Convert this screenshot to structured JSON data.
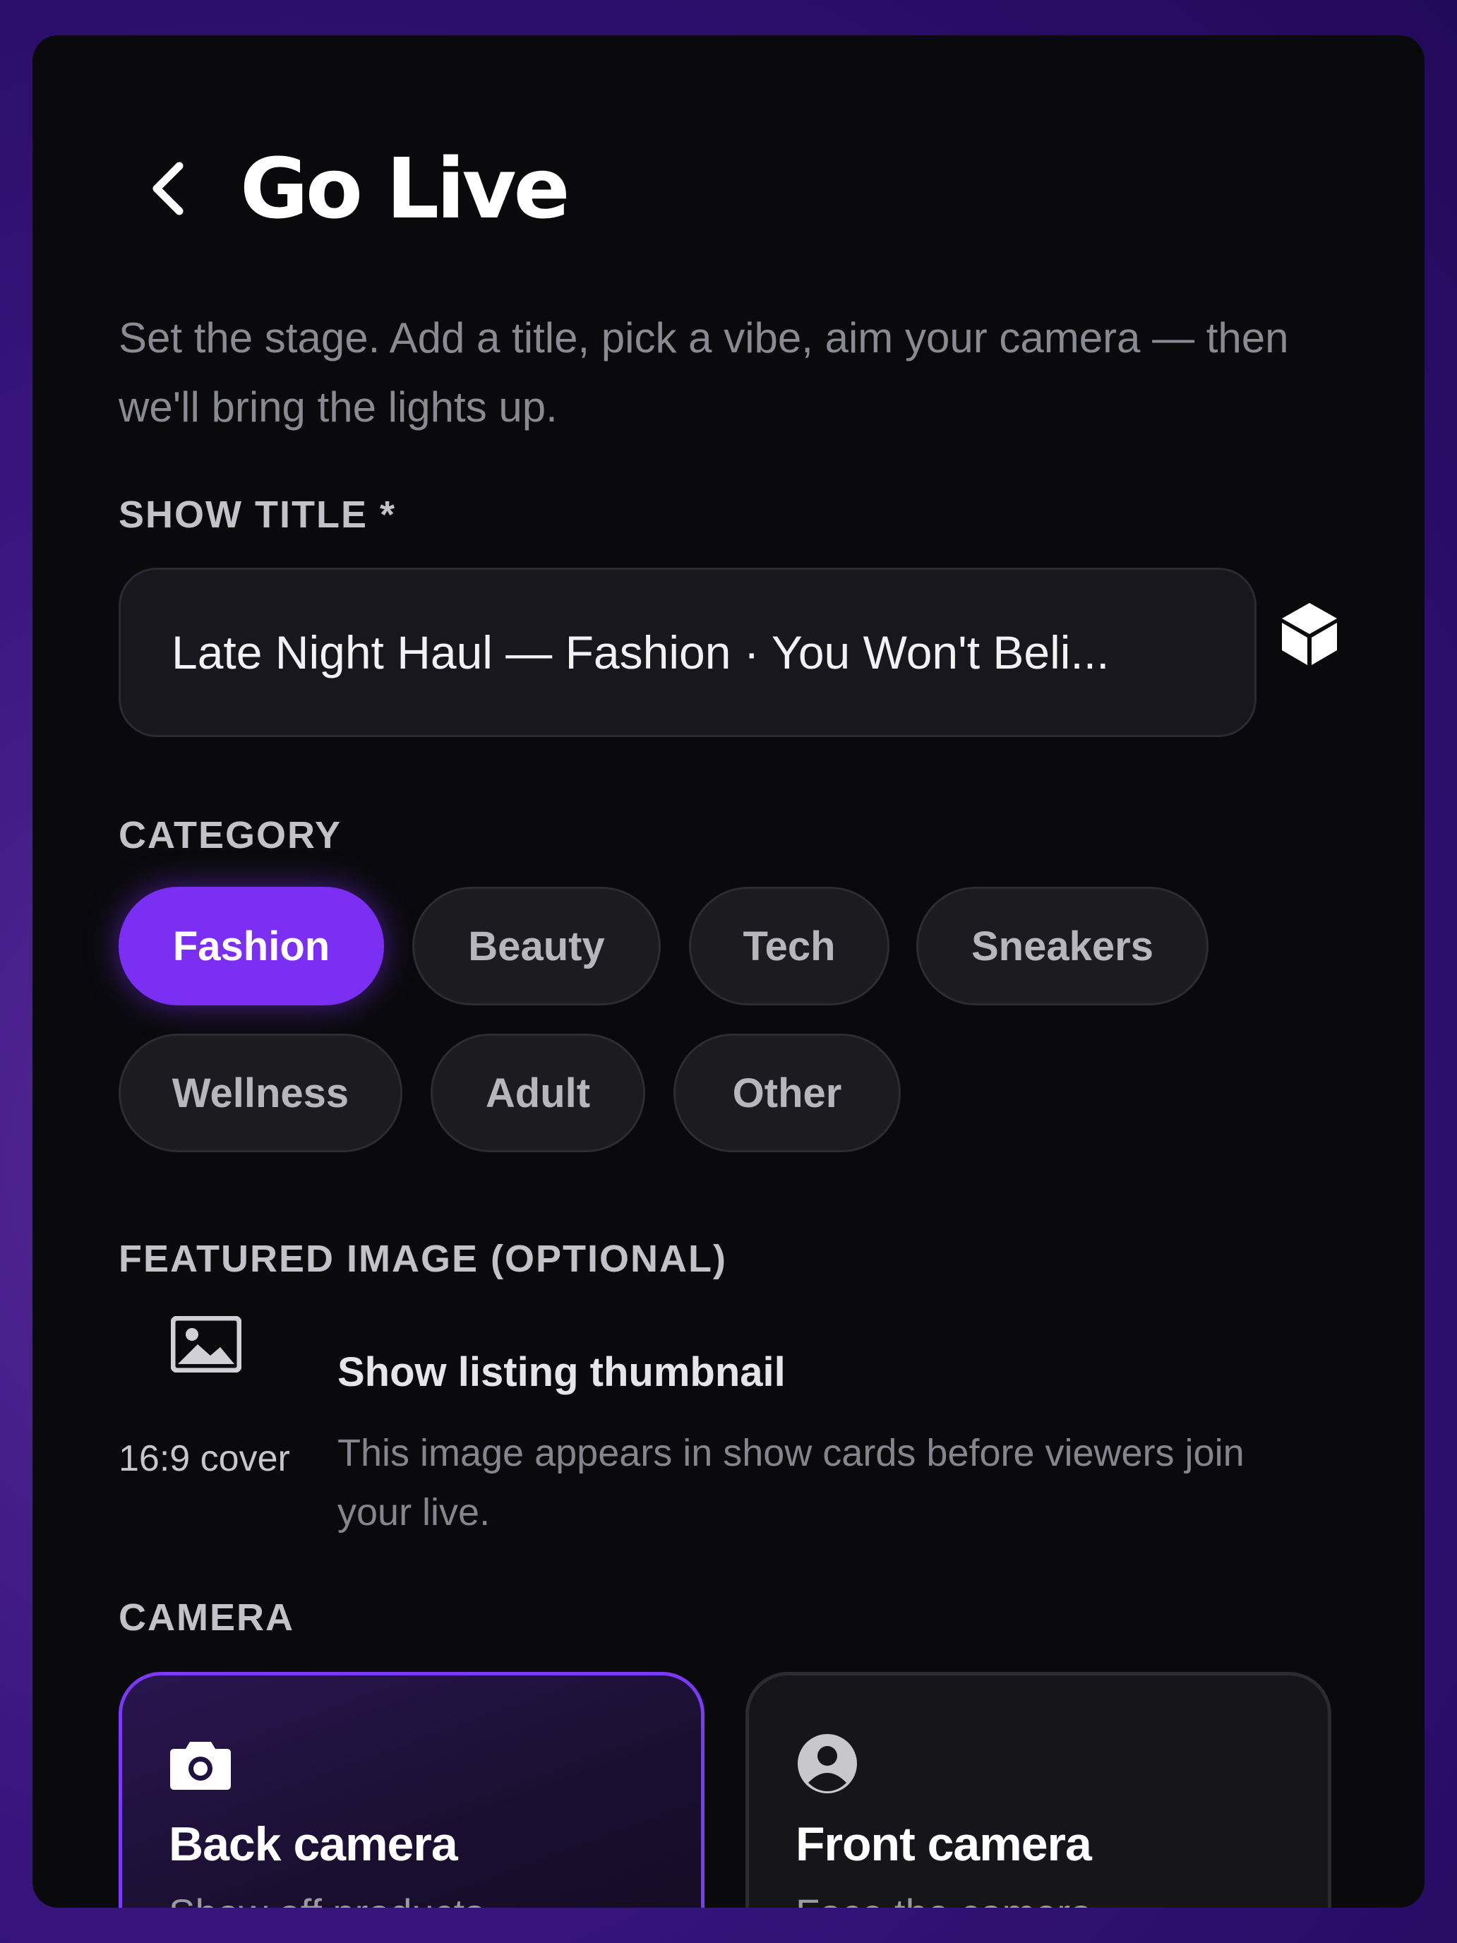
{
  "header": {
    "title": "Go Live"
  },
  "intro": "Set the stage. Add a title, pick a vibe, aim your camera — then we'll bring the lights up.",
  "show_title": {
    "label": "SHOW TITLE *",
    "value": "Late Night Haul — Fashion · You Won't Beli..."
  },
  "category": {
    "label": "CATEGORY",
    "chips": [
      "Fashion",
      "Beauty",
      "Tech",
      "Sneakers",
      "Wellness",
      "Adult",
      "Other"
    ],
    "selected": "Fashion"
  },
  "featured_image": {
    "label": "FEATURED IMAGE (OPTIONAL)",
    "caption": "16:9 cover",
    "title": "Show listing thumbnail",
    "description": "This image appears in show cards before viewers join your live."
  },
  "camera": {
    "label": "CAMERA",
    "options": [
      {
        "title": "Back camera",
        "subtitle": "Show off products",
        "icon": "camera-icon",
        "selected": true
      },
      {
        "title": "Front camera",
        "subtitle": "Face the camera",
        "icon": "person-icon",
        "selected": false
      }
    ]
  },
  "colors": {
    "accent": "#7b2ff2",
    "card_bg": "#0a0a0d",
    "page_bg": "#3a1680"
  }
}
